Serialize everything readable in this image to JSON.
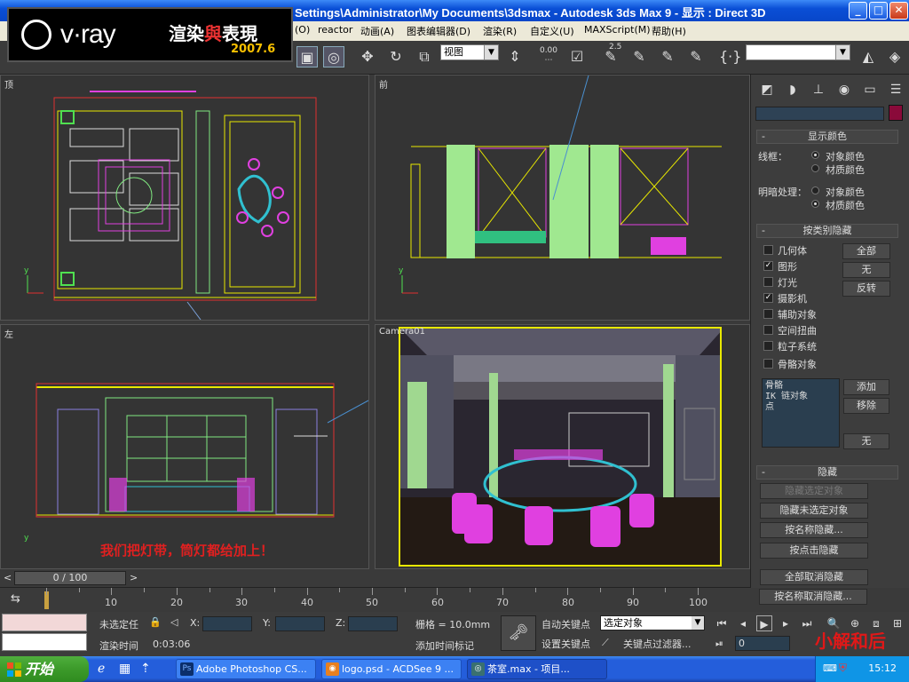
{
  "window": {
    "title": "Settings\\Administrator\\My Documents\\3dsmax - Autodesk 3ds Max 9 - 显示 : Direct 3D",
    "minimize": "_",
    "maximize": "□",
    "close": "✕"
  },
  "menu": {
    "items": [
      "(O)",
      "reactor",
      "动画(A)",
      "图表编辑器(D)",
      "渲染(R)",
      "自定义(U)",
      "MAXScript(M)",
      "帮助(H)"
    ]
  },
  "logo": {
    "brand": "v·ray",
    "tagline_a": "渲染",
    "tagline_b": "與",
    "tagline_c": "表現",
    "version": "2007.6"
  },
  "toolbar": {
    "view_dropdown": "视图",
    "selection_set_dropdown": "",
    "spinner_label_1": "2.5",
    "spinner_label_2": "0.00",
    "icons": [
      "region-select-icon",
      "window-crossing-icon",
      "move-icon",
      "rotate-icon",
      "scale-icon",
      "pivot-icon",
      "snap-icon",
      "percent-snap-icon",
      "spinner-snap-icon",
      "edit-named-selection-icon",
      "mirror-icon",
      "align-icon",
      "curly-braces-icon",
      "layer-icon",
      "curve-editor-icon"
    ]
  },
  "viewports": {
    "top": "顶",
    "front": "前",
    "left": "左",
    "camera": "Camera01"
  },
  "annotation": "我们把灯带，筒灯都给加上！",
  "panel": {
    "tab_icons": [
      "create-icon",
      "modify-icon",
      "hierarchy-icon",
      "motion-icon",
      "display-icon",
      "utilities-icon"
    ],
    "display_color": {
      "title": "显示颜色",
      "wireframe_label": "线框：",
      "shaded_label": "明暗处理：",
      "option_object": "对象颜色",
      "option_material": "材质颜色"
    },
    "hide_by_category": {
      "title": "按类别隐藏",
      "categories": [
        {
          "label": "几何体",
          "checked": false
        },
        {
          "label": "图形",
          "checked": true
        },
        {
          "label": "灯光",
          "checked": false
        },
        {
          "label": "摄影机",
          "checked": true
        },
        {
          "label": "辅助对象",
          "checked": false
        },
        {
          "label": "空间扭曲",
          "checked": false
        },
        {
          "label": "粒子系统",
          "checked": false
        },
        {
          "label": "骨骼对象",
          "checked": false
        }
      ],
      "btn_all": "全部",
      "btn_none": "无",
      "btn_invert": "反转",
      "list_items": [
        "骨骼",
        "IK 链对象",
        "点"
      ],
      "btn_add": "添加",
      "btn_remove": "移除",
      "btn_none2": "无"
    },
    "hide": {
      "title": "隐藏",
      "btn_hide_selected": "隐藏选定对象",
      "btn_hide_unselected": "隐藏未选定对象",
      "btn_hide_by_name": "按名称隐藏...",
      "btn_hide_by_hit": "按点击隐藏",
      "btn_unhide_all": "全部取消隐藏",
      "btn_unhide_by_name": "按名称取消隐藏..."
    }
  },
  "timeline": {
    "frame_counter": "0 / 100",
    "ticks": [
      "10",
      "20",
      "30",
      "40",
      "50",
      "60",
      "70",
      "80",
      "90",
      "100"
    ]
  },
  "status": {
    "selection": "未选定任",
    "x_label": "X:",
    "y_label": "Y:",
    "z_label": "Z:",
    "grid": "栅格 = 10.0mm",
    "render_time_label": "渲染时间",
    "render_time_value": "0:03:06",
    "add_time_tag": "添加时间标记",
    "auto_key": "自动关键点",
    "set_key": "设置关键点",
    "key_mode_dropdown": "选定对象",
    "key_filters": "关键点过滤器...",
    "current_frame": "0"
  },
  "taskbar": {
    "start": "开始",
    "tasks": [
      "Adobe Photoshop CS...",
      "logo.psd - ACDSee 9 ...",
      "茶室.max    - 项目..."
    ],
    "clock": "15:12"
  },
  "watermark": "小解和后",
  "colors": {
    "accent": "#245edb",
    "wire_yellow": "#e8e800",
    "wire_magenta": "#e040e0",
    "wire_green": "#80e880",
    "wire_cyan": "#30c0d0"
  }
}
